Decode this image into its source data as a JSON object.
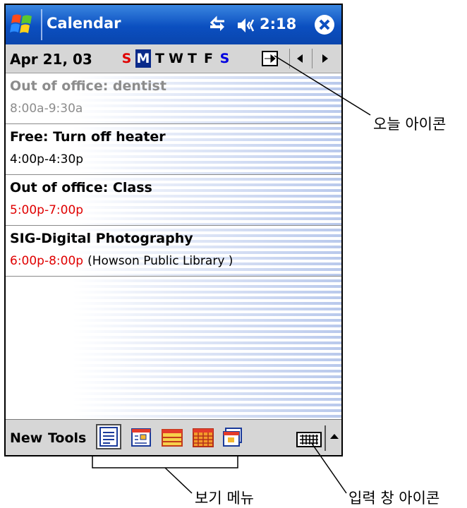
{
  "titlebar": {
    "app_title": "Calendar",
    "clock": "2:18"
  },
  "datebar": {
    "date": "Apr 21, 03",
    "weekdays": [
      "S",
      "M",
      "T",
      "W",
      "T",
      "F",
      "S"
    ],
    "selected_day_index": 1
  },
  "appointments": [
    {
      "title": "Out of office: dentist",
      "time": "8:00a-9:30a",
      "location": "",
      "past": true,
      "time_red": false
    },
    {
      "title": "Free: Turn off heater",
      "time": "4:00p-4:30p",
      "location": "",
      "past": false,
      "time_red": false
    },
    {
      "title": "Out of office: Class",
      "time": "5:00p-7:00p",
      "location": "",
      "past": false,
      "time_red": true
    },
    {
      "title": "SIG-Digital Photography",
      "time": "6:00p-8:00p",
      "location": "(Howson Public Library )",
      "past": false,
      "time_red": true
    }
  ],
  "toolbar": {
    "new_label": "New",
    "tools_label": "Tools",
    "active_view_index": 0
  },
  "callouts": {
    "today_icon": "오늘 아이콘",
    "view_menu": "보기 메뉴",
    "input_panel_icon": "입력 창 아이콘"
  },
  "colors": {
    "titlebar": "#0b4fc0",
    "accent_red": "#e00000",
    "sunday_saturday_blue": "#0000e0",
    "selected_day": "#0a2a8a"
  }
}
